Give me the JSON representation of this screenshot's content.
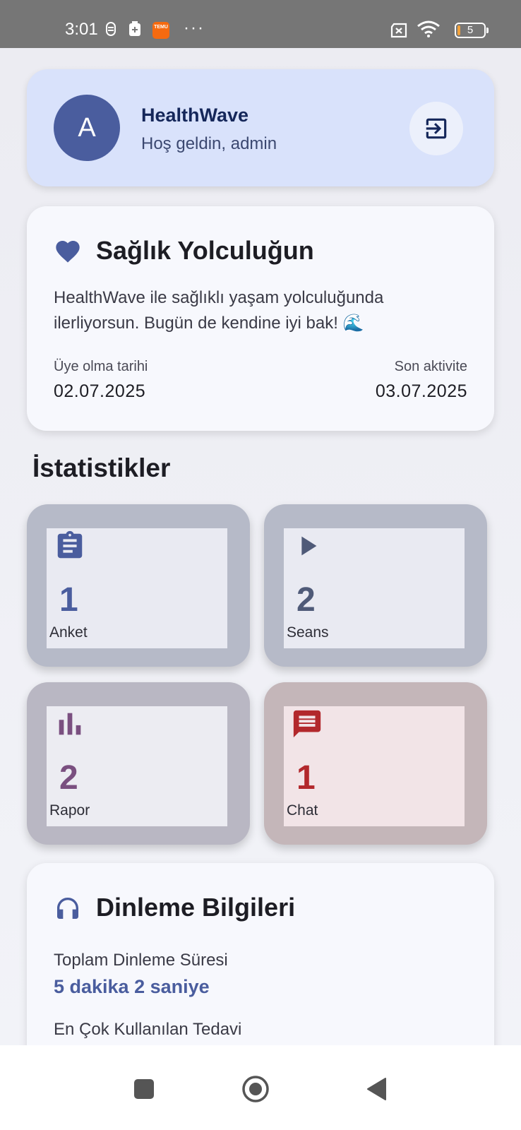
{
  "status_bar": {
    "time": "3:01",
    "temu_label": "TEMU",
    "more_dots": "···",
    "battery_level": "5"
  },
  "header": {
    "avatar_letter": "A",
    "app_name": "HealthWave",
    "welcome": "Hoş geldin, admin",
    "logout_icon": "logout-icon"
  },
  "journey": {
    "title": "Sağlık Yolculuğun",
    "text": "HealthWave ile sağlıklı yaşam yolculuğunda ilerliyorsun. Bugün de kendine iyi bak! 🌊",
    "member_since_label": "Üye olma tarihi",
    "member_since_value": "02.07.2025",
    "last_activity_label": "Son aktivite",
    "last_activity_value": "03.07.2025"
  },
  "stats": {
    "title": "İstatistikler",
    "items": [
      {
        "value": "1",
        "label": "Anket",
        "icon": "clipboard-icon",
        "color": "#4a5d9e"
      },
      {
        "value": "2",
        "label": "Seans",
        "icon": "play-icon",
        "color": "#4f5a78"
      },
      {
        "value": "2",
        "label": "Rapor",
        "icon": "bar-chart-icon",
        "color": "#7a4f80"
      },
      {
        "value": "1",
        "label": "Chat",
        "icon": "chat-icon",
        "color": "#b2282c"
      }
    ]
  },
  "listening": {
    "title": "Dinleme Bilgileri",
    "total_label": "Toplam Dinleme Süresi",
    "total_value": "5 dakika 2 saniye",
    "next_label": "En Çok Kullanılan Tedavi"
  },
  "nav": {
    "recent": "square-icon",
    "home": "circle-icon",
    "back": "back-triangle-icon"
  }
}
